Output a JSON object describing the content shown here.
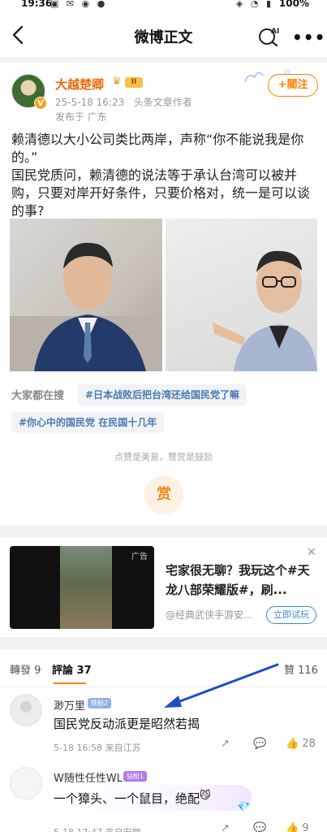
{
  "status": {
    "time": "19:36",
    "battery": "100%"
  },
  "nav": {
    "title": "微博正文",
    "ai_label": "AI"
  },
  "post": {
    "author": "大越楚卿",
    "level_badge": "II",
    "time": "25-5-18 16:23",
    "source": "头条文章作者",
    "location": "发布于 广东",
    "follow_label": "+關注",
    "text": "赖清德以大小公司类比两岸，声称“你不能说我是你的。”\n国民党质问，赖清德的说法等于承认台湾可以被并购，只要对岸开好条件，只要价格对，统一是可以谈的事?",
    "search_label": "大家都在搜",
    "tags": [
      "#日本战败后把台湾还给国民党了嘛",
      "#你心中的国民党 在民国十几年"
    ],
    "reward_text": "点赞是美意，赞赏是鼓励",
    "reward_button": "赏"
  },
  "ad": {
    "label": "广告",
    "text": "宅家很无聊？我玩这个#天龙八部荣耀版#，刷...",
    "source": "@经典武侠手游安...",
    "button": "立即试玩"
  },
  "tabs": {
    "repost": "轉發 9",
    "comment": "評論 37",
    "like": "贊 116"
  },
  "comments": [
    {
      "name": "渺万里",
      "badge": "铁粉2",
      "text": "国民党反动派更是昭然若揭",
      "meta": "5-18 16:58  来自江苏",
      "likes": "28"
    },
    {
      "name": "W随性任性WL",
      "badge": "钻粉1",
      "text": "一个獐头、一个鼠目，绝配",
      "meta": "5-18 17:47  来自安徽",
      "likes": "9"
    }
  ],
  "colors": {
    "accent": "#ff8200",
    "link": "#4a7ab5",
    "arrow": "#1f4fbf"
  }
}
